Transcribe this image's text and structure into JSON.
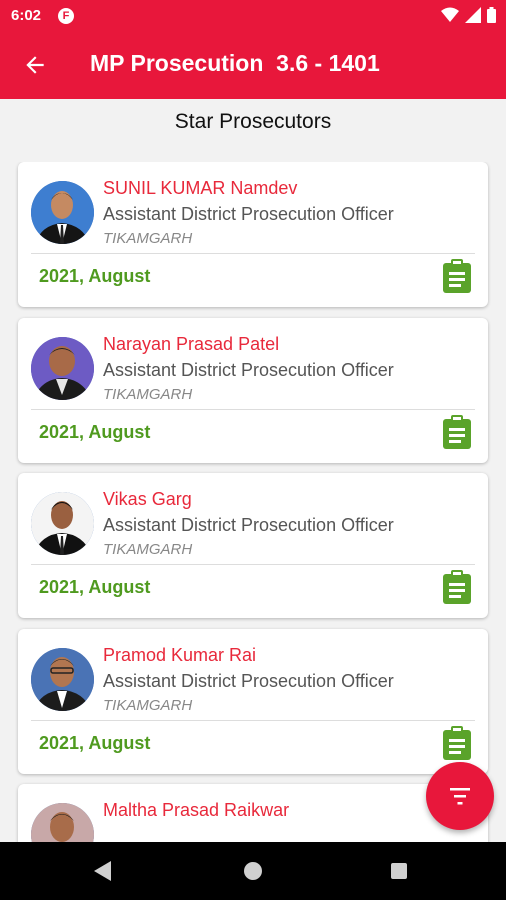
{
  "status_bar": {
    "time": "6:02",
    "notification_badge": "F"
  },
  "app_bar": {
    "title": "MP Prosecution  3.6 - 1401"
  },
  "page": {
    "section_title": "Star Prosecutors"
  },
  "prosecutors": [
    {
      "name": "SUNIL KUMAR Namdev",
      "designation": "Assistant District Prosecution Officer",
      "district": "TIKAMGARH",
      "month": "2021, August"
    },
    {
      "name": "Narayan Prasad Patel",
      "designation": "Assistant District Prosecution Officer",
      "district": "TIKAMGARH",
      "month": "2021, August"
    },
    {
      "name": "Vikas Garg",
      "designation": "Assistant District Prosecution Officer",
      "district": "TIKAMGARH",
      "month": "2021, August"
    },
    {
      "name": "Pramod Kumar Rai",
      "designation": "Assistant District Prosecution Officer",
      "district": "TIKAMGARH",
      "month": "2021, August"
    },
    {
      "name": "Maltha Prasad Raikwar",
      "designation": "",
      "district": "",
      "month": ""
    }
  ],
  "colors": {
    "primary": "#e8173b",
    "name": "#e8293b",
    "date": "#4f9a1f",
    "background": "#f2f2f2"
  },
  "icons": {
    "back": "arrow-left-icon",
    "details": "clipboard-icon",
    "filter": "filter-icon"
  }
}
